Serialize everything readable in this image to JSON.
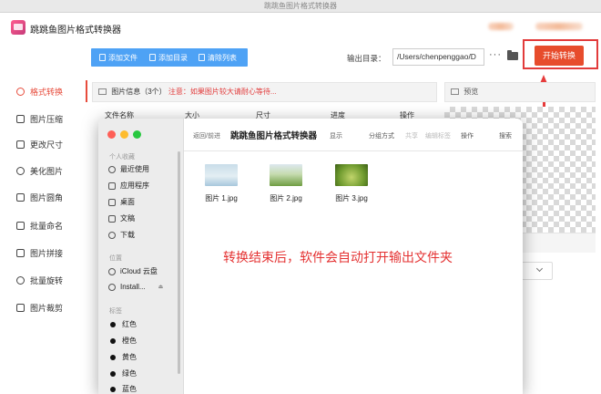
{
  "window": {
    "title": "跳跳鱼图片格式转换器"
  },
  "app": {
    "title": "跳跳鱼图片格式转换器",
    "brand_color": "#e74c3c",
    "accent_color": "#4ea2f5"
  },
  "toolbar": {
    "add_file": "添加文件",
    "add_folder": "添加目录",
    "clear_list": "清除列表",
    "output_label": "输出目录：",
    "output_path": "/Users/chenpenggao/D",
    "more": "···",
    "start_button": "开始转换"
  },
  "sidebar": {
    "items": [
      {
        "label": "格式转换",
        "icon": "refresh-icon"
      },
      {
        "label": "图片压缩",
        "icon": "compress-icon"
      },
      {
        "label": "更改尺寸",
        "icon": "resize-icon"
      },
      {
        "label": "美化图片",
        "icon": "palette-icon"
      },
      {
        "label": "图片圆角",
        "icon": "round-corner-icon"
      },
      {
        "label": "批量命名",
        "icon": "rename-icon"
      },
      {
        "label": "图片拼接",
        "icon": "stitch-icon"
      },
      {
        "label": "批量旋转",
        "icon": "rotate-icon"
      },
      {
        "label": "图片裁剪",
        "icon": "crop-icon"
      }
    ]
  },
  "list_panel": {
    "info": "图片信息（3个）",
    "warning": "注意：如果图片较大请耐心等待...",
    "columns": [
      "文件名称",
      "大小",
      "尺寸",
      "进度",
      "操作"
    ]
  },
  "preview": {
    "title": "预览"
  },
  "finder": {
    "nav": "返回/前进",
    "title": "跳跳鱼图片格式转换器",
    "toolbar": [
      "显示",
      "分组方式",
      "共享",
      "编辑标签",
      "操作",
      "搜索"
    ],
    "sidebar_sections": {
      "favorites": "个人收藏",
      "locations": "位置",
      "tags": "标签"
    },
    "favorites": [
      "最近使用",
      "应用程序",
      "桌面",
      "文稿",
      "下载"
    ],
    "locations": [
      "iCloud 云盘",
      "Install..."
    ],
    "tags": [
      "红色",
      "橙色",
      "黄色",
      "绿色",
      "蓝色"
    ],
    "files": [
      "图片 1.jpg",
      "图片 2.jpg",
      "图片 3.jpg"
    ]
  },
  "annotation": {
    "caption": "转换结束后，软件会自动打开输出文件夹",
    "color": "#e43232"
  }
}
